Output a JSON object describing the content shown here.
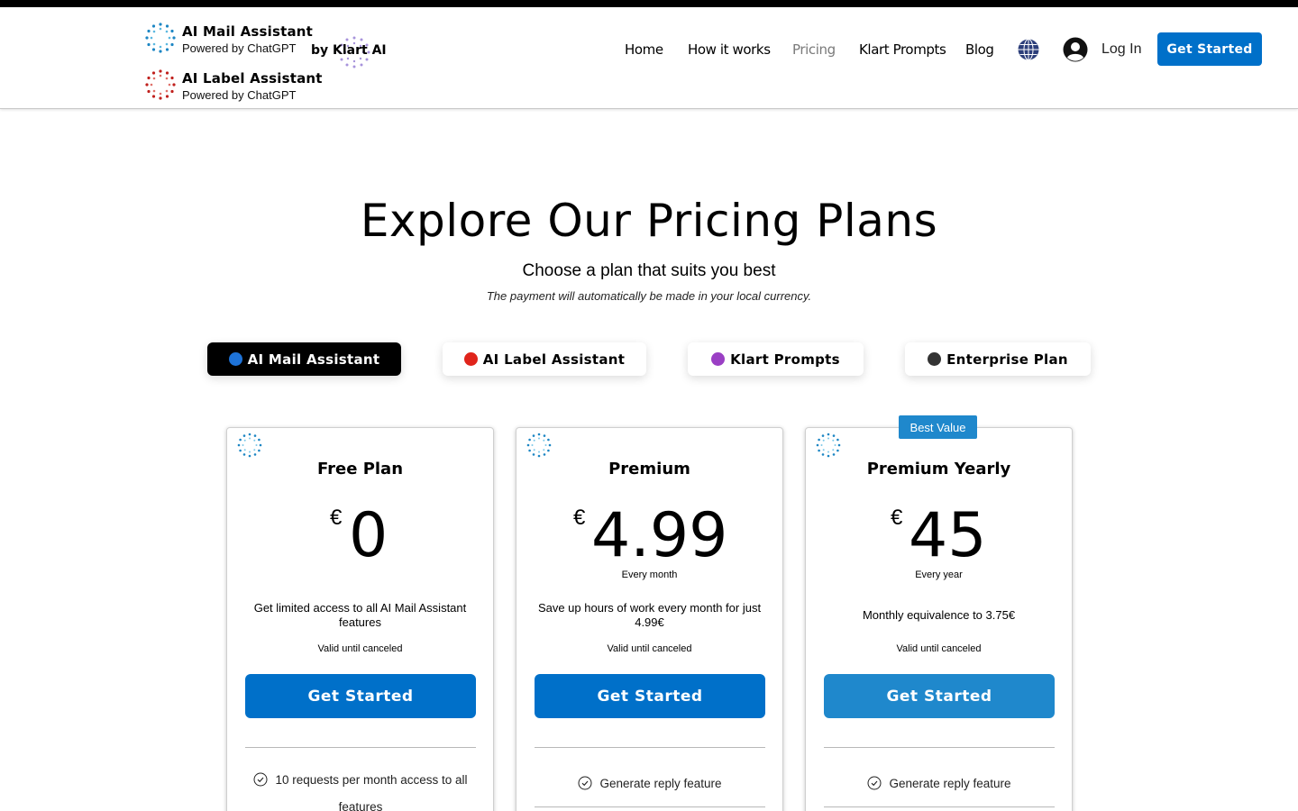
{
  "header": {
    "brands": [
      {
        "title": "AI Mail Assistant",
        "subtitle": "Powered by ChatGPT",
        "icon": "blue-dots-logo-icon"
      },
      {
        "title": "AI Label Assistant",
        "subtitle": "Powered by ChatGPT",
        "icon": "red-dots-logo-icon"
      }
    ],
    "by_label": "by Klart AI",
    "nav": [
      "Home",
      "How it works",
      "Pricing",
      "Klart Prompts",
      "Blog"
    ],
    "active_nav": "Pricing",
    "login_label": "Log In",
    "cta_label": "Get Started"
  },
  "hero": {
    "title": "Explore Our Pricing Plans",
    "subtitle": "Choose a plan that suits you best",
    "note": "The payment will automatically be made in your local currency."
  },
  "tabs": [
    {
      "label": "AI Mail Assistant",
      "dot_color": "#1e73d8"
    },
    {
      "label": "AI Label Assistant",
      "dot_color": "#e0241b"
    },
    {
      "label": "Klart Prompts",
      "dot_color": "#9a3fc4"
    },
    {
      "label": "Enterprise Plan",
      "dot_color": "#333333"
    }
  ],
  "active_tab": "AI Mail Assistant",
  "plans": [
    {
      "name": "Free Plan",
      "currency": "€",
      "price": "0",
      "period": "",
      "description": "Get limited access to all AI Mail Assistant features",
      "validity": "Valid until canceled",
      "button": "Get Started",
      "feature": "10 requests per month access to all features"
    },
    {
      "name": "Premium",
      "currency": "€",
      "price": "4.99",
      "period": "Every month",
      "description": "Save up hours of work every month for just 4.99€",
      "validity": "Valid until canceled",
      "button": "Get Started",
      "feature": "Generate reply feature"
    },
    {
      "name": "Premium Yearly",
      "currency": "€",
      "price": "45",
      "period": "Every year",
      "description": "Monthly equivalence to 3.75€",
      "validity": "Valid until canceled",
      "button": "Get Started",
      "feature": "Generate reply feature",
      "badge": "Best Value"
    }
  ],
  "colors": {
    "accent": "#0070c9",
    "accent_light": "#1f88cc",
    "active_tab_bg": "#000000"
  }
}
